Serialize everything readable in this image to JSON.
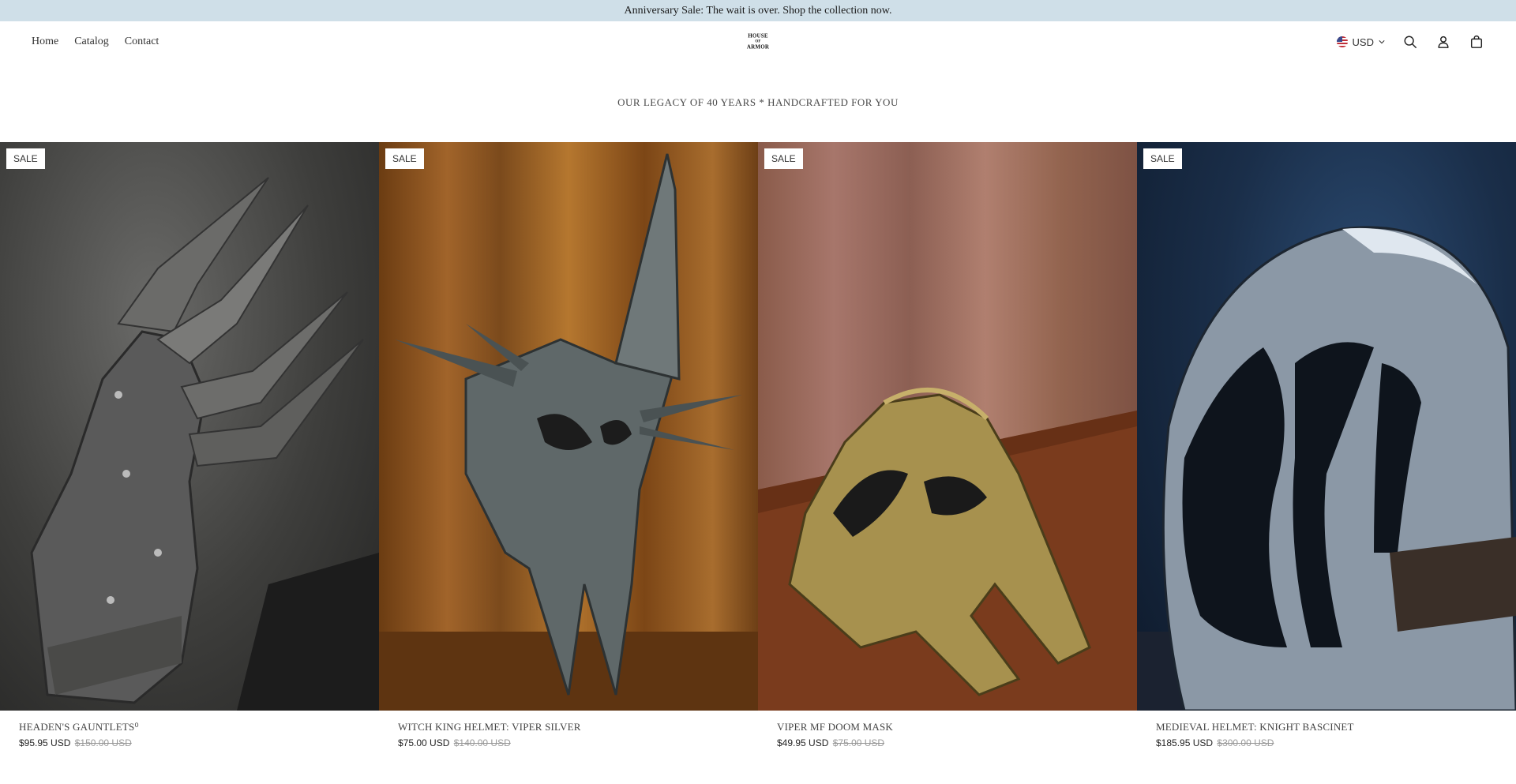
{
  "announcement": {
    "text": "Anniversary Sale: The wait is over. Shop the collection now."
  },
  "header": {
    "nav": [
      {
        "label": "Home"
      },
      {
        "label": "Catalog"
      },
      {
        "label": "Contact"
      }
    ],
    "logo": {
      "line1": "HOUSE",
      "line2": "OF",
      "line3": "ARMOR"
    },
    "currency": {
      "label": "USD",
      "icon": "us-flag-icon"
    },
    "icons": [
      "search-icon",
      "account-icon",
      "cart-icon"
    ]
  },
  "tagline": {
    "text": "OUR LEGACY OF 40 YEARS * HANDCRAFTED FOR YOU"
  },
  "products": [
    {
      "badge": "SALE",
      "title": "HEADEN'S GAUNTLETS⁰",
      "price": "$95.95 USD",
      "compare_price": "$150.00 USD"
    },
    {
      "badge": "SALE",
      "title": "WITCH KING HELMET: VIPER SILVER",
      "price": "$75.00 USD",
      "compare_price": "$140.00 USD"
    },
    {
      "badge": "SALE",
      "title": "VIPER MF DOOM MASK",
      "price": "$49.95 USD",
      "compare_price": "$75.00 USD"
    },
    {
      "badge": "SALE",
      "title": "MEDIEVAL HELMET: KNIGHT BASCINET",
      "price": "$185.95 USD",
      "compare_price": "$300.00 USD"
    }
  ]
}
